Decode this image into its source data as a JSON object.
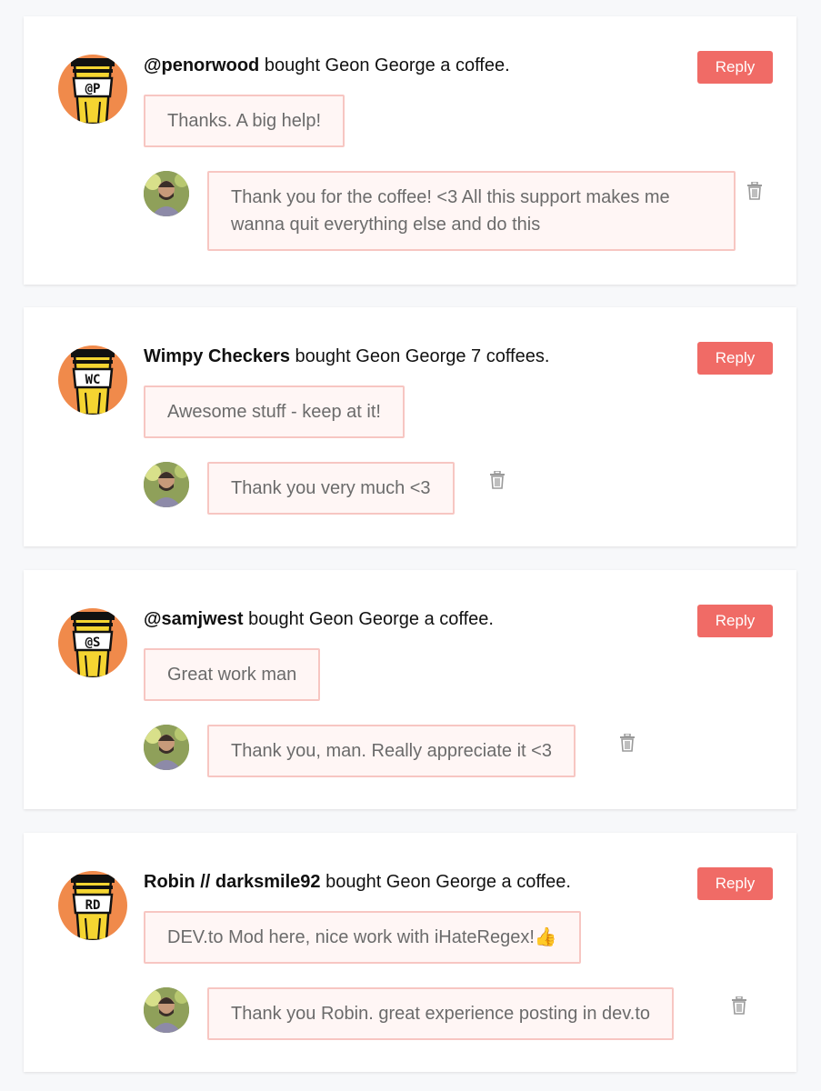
{
  "supporters": [
    {
      "name": "@penorwood",
      "action": " bought Geon George a coffee.",
      "initials": "@P",
      "message": "Thanks. A big help!",
      "reply": "Thank you for the coffee! <3  All this support makes me wanna quit everything else and do this"
    },
    {
      "name": "Wimpy Checkers",
      "action": " bought Geon George 7 coffees.",
      "initials": "WC",
      "message": "Awesome stuff - keep at it!",
      "reply": "Thank you very much <3"
    },
    {
      "name": "@samjwest",
      "action": " bought Geon George a coffee.",
      "initials": "@S",
      "message": "Great work man",
      "reply": "Thank you, man. Really appreciate it <3"
    },
    {
      "name": "Robin // darksmile92",
      "action": " bought Geon George a coffee.",
      "initials": "RD",
      "message": "DEV.to Mod here, nice work with iHateRegex!👍",
      "reply": "Thank you Robin. great experience posting in dev.to"
    }
  ],
  "reply_button_label": "Reply",
  "icons": {
    "avatar": "coffee-cup-icon",
    "delete": "trash-icon"
  },
  "colors": {
    "reply_button": "#f06b66",
    "bubble_bg": "#fff6f5",
    "bubble_border": "#f7c6c2",
    "avatar_bg": "#f08a4b",
    "cup_yellow": "#f5d531"
  }
}
